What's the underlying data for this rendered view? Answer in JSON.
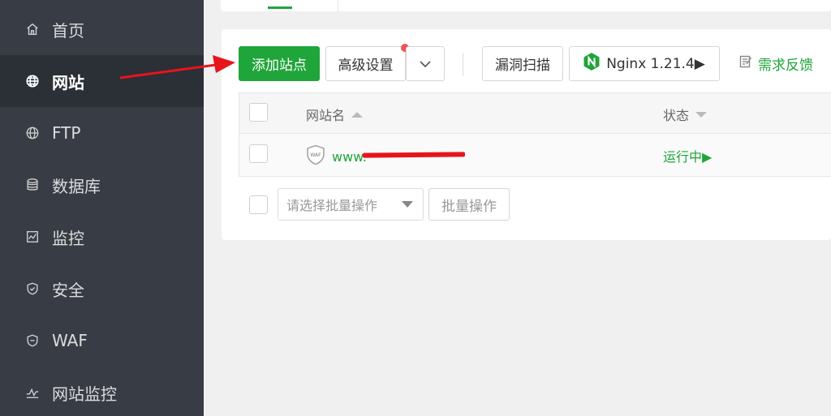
{
  "sidebar": {
    "items": [
      {
        "label": "首页",
        "icon": "home-icon",
        "active": false
      },
      {
        "label": "网站",
        "icon": "globe-icon",
        "active": true
      },
      {
        "label": "FTP",
        "icon": "ftp-globe-icon",
        "active": false
      },
      {
        "label": "数据库",
        "icon": "database-icon",
        "active": false
      },
      {
        "label": "监控",
        "icon": "monitor-chart-icon",
        "active": false
      },
      {
        "label": "安全",
        "icon": "shield-icon",
        "active": false
      },
      {
        "label": "WAF",
        "icon": "waf-shield-icon",
        "active": false
      },
      {
        "label": "网站监控",
        "icon": "line-chart-icon",
        "active": false
      }
    ]
  },
  "toolbar": {
    "add_site": "添加站点",
    "advanced_settings": "高级设置",
    "vuln_scan": "漏洞扫描",
    "nginx": "Nginx 1.21.4▶",
    "feedback": "需求反馈"
  },
  "table": {
    "col_name": "网站名",
    "col_status": "状态",
    "rows": [
      {
        "name": "www.",
        "status": "运行中▶",
        "waf_badge": "WAF"
      }
    ]
  },
  "batch": {
    "select_placeholder": "请选择批量操作",
    "apply_label": "批量操作"
  },
  "colors": {
    "sidebar_bg": "#383c45",
    "sidebar_active": "#2b2f36",
    "primary_green": "#20a53a",
    "notification_dot": "#ef5350",
    "annotation_red": "#e8141c"
  }
}
